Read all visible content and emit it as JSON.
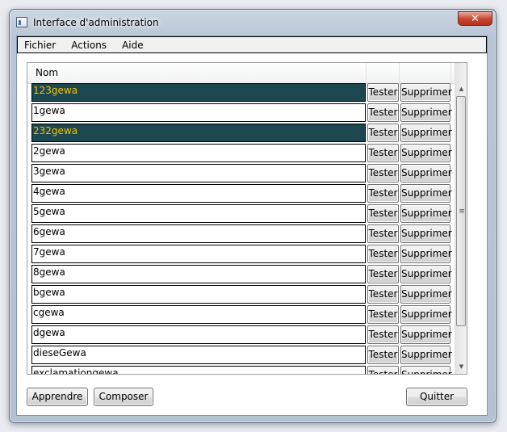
{
  "window": {
    "title": "Interface d'administration",
    "close_glyph": "✕"
  },
  "menu": [
    "Fichier",
    "Actions",
    "Aide"
  ],
  "grid": {
    "columns": [
      "Nom",
      "",
      ""
    ],
    "rows": [
      {
        "name": "123gewa",
        "selected": true
      },
      {
        "name": "1gewa",
        "selected": false
      },
      {
        "name": "232gewa",
        "selected": true
      },
      {
        "name": "2gewa",
        "selected": false
      },
      {
        "name": "3gewa",
        "selected": false
      },
      {
        "name": "4gewa",
        "selected": false
      },
      {
        "name": "5gewa",
        "selected": false
      },
      {
        "name": "6gewa",
        "selected": false
      },
      {
        "name": "7gewa",
        "selected": false
      },
      {
        "name": "8gewa",
        "selected": false
      },
      {
        "name": "bgewa",
        "selected": false
      },
      {
        "name": "cgewa",
        "selected": false
      },
      {
        "name": "dgewa",
        "selected": false
      },
      {
        "name": "dieseGewa",
        "selected": false
      },
      {
        "name": "exclamationgewa",
        "selected": false
      }
    ],
    "row_buttons": {
      "test_label": "Tester",
      "delete_label": "Supprimer"
    },
    "selected_row_colors": {
      "background": "#1e484f",
      "text": "#f2c200"
    }
  },
  "scrollbar": {
    "up_glyph": "▲",
    "down_glyph": "▼",
    "grip_glyph": "≡"
  },
  "actions": {
    "learn_label": "Apprendre",
    "compose_label": "Composer",
    "quit_label": "Quitter"
  }
}
